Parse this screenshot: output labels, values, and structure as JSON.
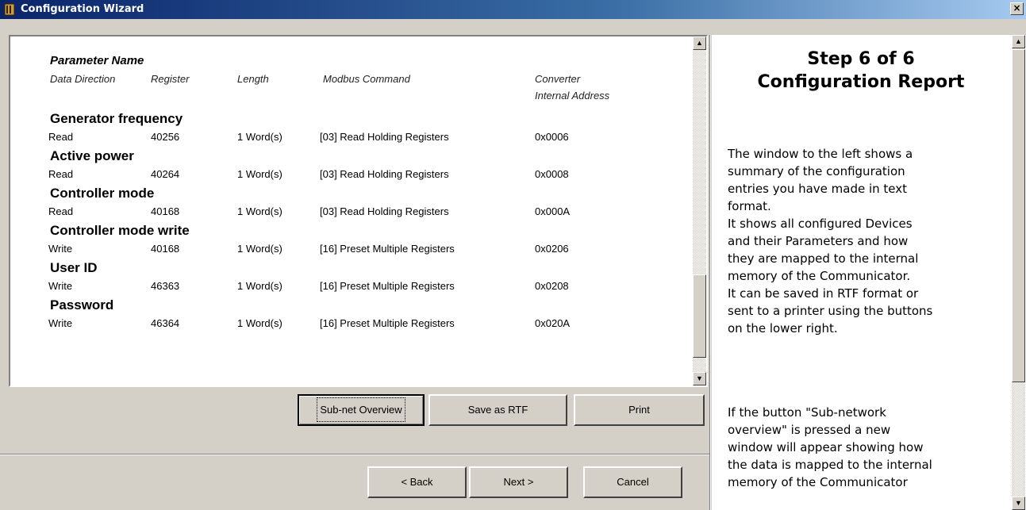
{
  "window": {
    "title": "Configuration Wizard",
    "close_glyph": "×",
    "icon": "wizard-app-icon"
  },
  "report": {
    "header": {
      "parameter_name": "Parameter Name",
      "data_direction": "Data Direction",
      "register": "Register",
      "length": "Length",
      "modbus_command": "Modbus Command",
      "converter_line1": "Converter",
      "converter_line2": "Internal Address"
    },
    "parameters": [
      {
        "name": "Generator frequency",
        "direction": "Read",
        "register": "40256",
        "length": "1 Word(s)",
        "command": "[03] Read Holding Registers",
        "address": "0x0006"
      },
      {
        "name": "Active power",
        "direction": "Read",
        "register": "40264",
        "length": "1 Word(s)",
        "command": "[03] Read Holding Registers",
        "address": "0x0008"
      },
      {
        "name": "Controller mode",
        "direction": "Read",
        "register": "40168",
        "length": "1 Word(s)",
        "command": "[03] Read Holding Registers",
        "address": "0x000A"
      },
      {
        "name": "Controller mode write",
        "direction": "Write",
        "register": "40168",
        "length": "1 Word(s)",
        "command": "[16] Preset Multiple Registers",
        "address": "0x0206"
      },
      {
        "name": "User ID",
        "direction": "Write",
        "register": "46363",
        "length": "1 Word(s)",
        "command": "[16] Preset Multiple Registers",
        "address": "0x0208"
      },
      {
        "name": "Password",
        "direction": "Write",
        "register": "46364",
        "length": "1 Word(s)",
        "command": "[16] Preset Multiple Registers",
        "address": "0x020A"
      }
    ]
  },
  "scroll": {
    "up": "▲",
    "down": "▼"
  },
  "actions": {
    "subnet": "Sub-net Overview",
    "save_rtf": "Save as RTF",
    "print": "Print"
  },
  "nav": {
    "back": "< Back",
    "next": "Next >",
    "cancel": "Cancel"
  },
  "help": {
    "heading_line1": "Step 6 of 6",
    "heading_line2": "Configuration Report",
    "para1": "The window to the left shows a\nsummary of the configuration\nentries you have made in text\nformat.\nIt shows all configured Devices\nand their Parameters and how\nthey are mapped to the internal\nmemory of the Communicator.\nIt can be saved in RTF format or\nsent to a printer using the buttons\non the lower right.",
    "para2": "If the button \"Sub-network\noverview\" is pressed a new\nwindow will appear showing how\nthe data is mapped to the internal\nmemory of the Communicator"
  }
}
